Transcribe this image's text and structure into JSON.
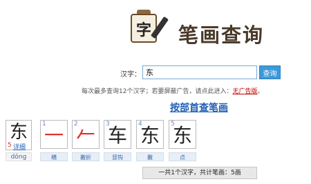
{
  "header": {
    "logo_char": "字",
    "site_title": "笔画查询"
  },
  "search": {
    "label": "汉字：",
    "value": "东",
    "button": "查询"
  },
  "notice": {
    "text": "每次最多查询12个汉字；若要屏蔽广告，请点此进入：",
    "link": "无广告版",
    "end": "。"
  },
  "section": {
    "heading": "按部首查笔画"
  },
  "character": {
    "glyph": "东",
    "stroke_count": "5",
    "detail_link": "详细",
    "pinyin": "dōng"
  },
  "strokes": [
    {
      "num": "1",
      "glyph": "一",
      "name": "横"
    },
    {
      "num": "2",
      "glyph": "𠂉",
      "name": "撇折"
    },
    {
      "num": "3",
      "glyph": "车",
      "name": "竖钩"
    },
    {
      "num": "4",
      "glyph": "东",
      "name": "撇"
    },
    {
      "num": "5",
      "glyph": "东",
      "name": "点"
    }
  ],
  "summary": {
    "text": "一共1个汉字，共计笔画：5画"
  }
}
